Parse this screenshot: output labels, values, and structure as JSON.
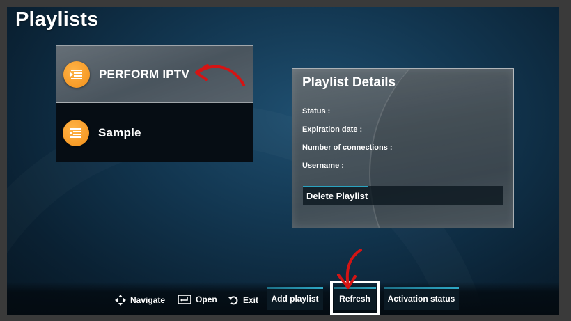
{
  "page": {
    "title": "Playlists"
  },
  "playlists": [
    {
      "label": "PERFORM IPTV",
      "selected": true,
      "icon": "playlist-icon"
    },
    {
      "label": "Sample",
      "selected": false,
      "icon": "playlist-icon"
    }
  ],
  "details": {
    "title": "Playlist Details",
    "rows": [
      "Status :",
      "Expiration date :",
      "Number of connections :",
      "Username :"
    ],
    "delete_label": "Delete Playlist"
  },
  "bottom_bar": {
    "hints": [
      {
        "label": "Navigate",
        "icon": "navigate-arrows-icon"
      },
      {
        "label": "Open",
        "icon": "open-enter-icon"
      },
      {
        "label": "Exit",
        "icon": "exit-back-icon"
      }
    ],
    "buttons": [
      "Add playlist",
      "Refresh",
      "Activation status"
    ]
  },
  "colors": {
    "accent": "#2ea8c5",
    "icon_orange": "#f39019",
    "annotation_red": "#d41414"
  }
}
